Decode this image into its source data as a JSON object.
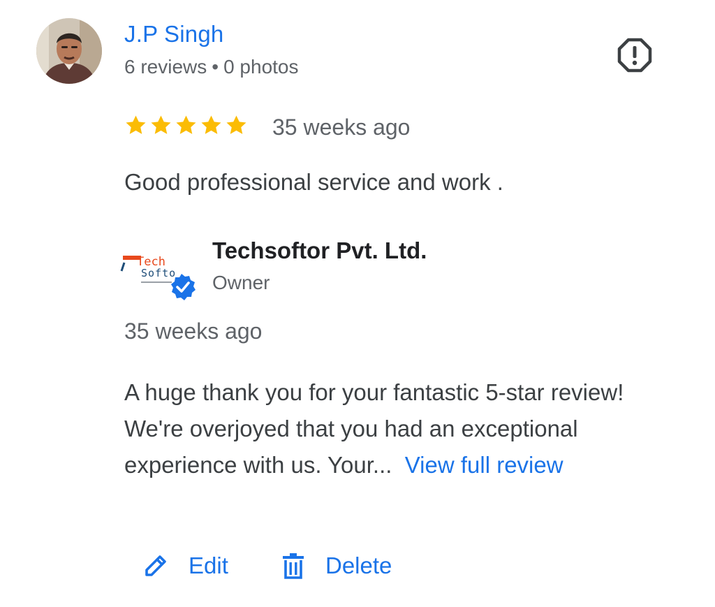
{
  "reviewer": {
    "name": "J.P Singh",
    "reviews": "6 reviews",
    "separator": "•",
    "photos": "0 photos",
    "avatar_icon": "user-photo-avatar"
  },
  "review": {
    "rating": 5,
    "max_rating": 5,
    "star_color": "#fbbc04",
    "time": "35 weeks ago",
    "text": "Good professional service and work ."
  },
  "report_icon": "exclamation-octagon-icon",
  "owner_reply": {
    "business_name": "Techsoftor Pvt. Ltd.",
    "role": "Owner",
    "logo_icon": "techsoftor-logo-with-verified-badge",
    "logo_text_line1": "Tech",
    "logo_text_line2": "Softo",
    "time": "35 weeks ago",
    "text": "A huge thank you for your fantastic 5-star review! We're overjoyed that you had an exceptional experience with us. Your...",
    "view_full_label": "View full review"
  },
  "actions": {
    "edit_label": "Edit",
    "edit_icon": "pencil-icon",
    "delete_label": "Delete",
    "delete_icon": "trash-icon"
  },
  "colors": {
    "link_blue": "#1a73e8",
    "text_primary": "#3c4043",
    "text_secondary": "#5f6368",
    "star": "#fbbc04",
    "verified": "#1a73e8"
  }
}
